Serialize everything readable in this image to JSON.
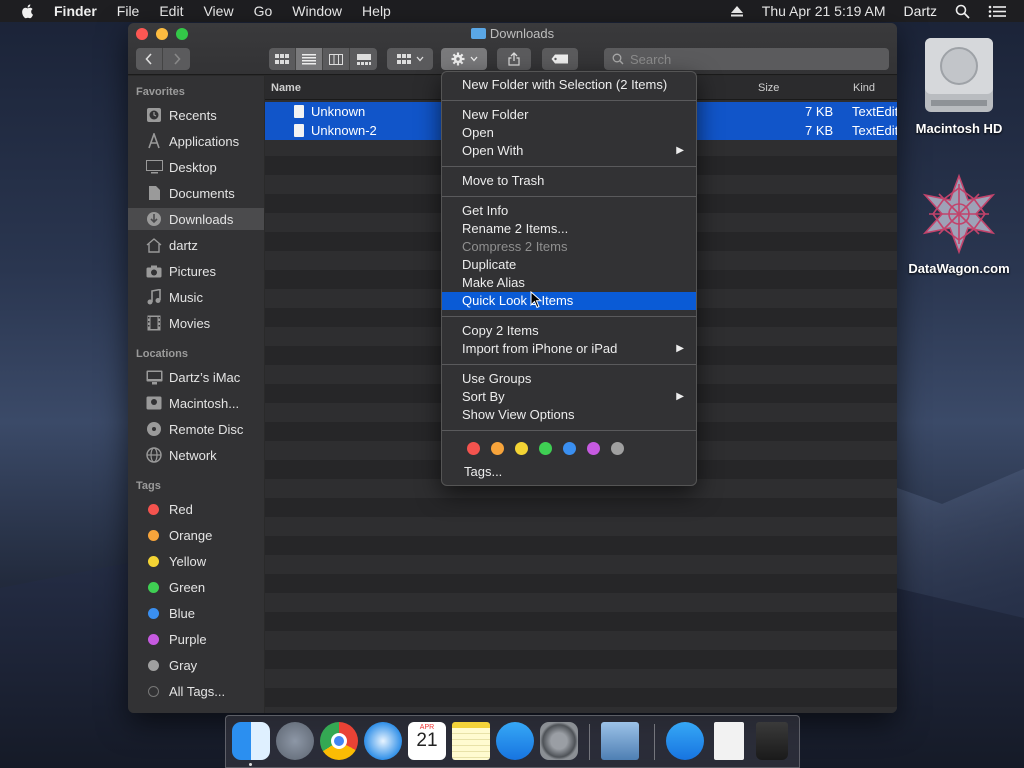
{
  "menubar": {
    "app": "Finder",
    "items": [
      "File",
      "Edit",
      "View",
      "Go",
      "Window",
      "Help"
    ],
    "datetime": "Thu Apr 21  5:19 AM",
    "user": "Dartz"
  },
  "window": {
    "title": "Downloads",
    "search_placeholder": "Search"
  },
  "sidebar": {
    "favorites_header": "Favorites",
    "favorites": [
      "Recents",
      "Applications",
      "Desktop",
      "Documents",
      "Downloads",
      "dartz",
      "Pictures",
      "Music",
      "Movies"
    ],
    "locations_header": "Locations",
    "locations": [
      "Dartz’s iMac",
      "Macintosh...",
      "Remote Disc",
      "Network"
    ],
    "tags_header": "Tags",
    "tags": [
      "Red",
      "Orange",
      "Yellow",
      "Green",
      "Blue",
      "Purple",
      "Gray",
      "All Tags..."
    ],
    "tag_colors": [
      "#f4534e",
      "#f7a43b",
      "#f4d434",
      "#3fcf53",
      "#3a8ff0",
      "#c65ae0",
      "#a0a0a0"
    ]
  },
  "columns": {
    "name": "Name",
    "size": "Size",
    "kind": "Kind"
  },
  "files": [
    {
      "name": "Unknown",
      "size": "7 KB",
      "kind": "TextEdit"
    },
    {
      "name": "Unknown-2",
      "size": "7 KB",
      "kind": "TextEdit"
    }
  ],
  "context_menu": {
    "new_folder_selection": "New Folder with Selection (2 Items)",
    "new_folder": "New Folder",
    "open": "Open",
    "open_with": "Open With",
    "move_to_trash": "Move to Trash",
    "get_info": "Get Info",
    "rename": "Rename 2 Items...",
    "compress": "Compress 2 Items",
    "duplicate": "Duplicate",
    "make_alias": "Make Alias",
    "quick_look": "Quick Look 2 Items",
    "copy": "Copy 2 Items",
    "import": "Import from iPhone or iPad",
    "use_groups": "Use Groups",
    "sort_by": "Sort By",
    "show_view_options": "Show View Options",
    "tags": "Tags...",
    "tag_colors": [
      "#f4534e",
      "#f7a43b",
      "#f4d434",
      "#3fcf53",
      "#3a8ff0",
      "#c65ae0",
      "#a0a0a0"
    ]
  },
  "desktop": {
    "icons": [
      "Macintosh HD",
      "DataWagon.com"
    ]
  },
  "dock": {
    "calendar_month": "APR",
    "calendar_day": "21",
    "apps": [
      "finder-icon",
      "launchpad-icon",
      "chrome-icon",
      "safari-icon",
      "calendar-icon",
      "notes-icon",
      "app-store-icon",
      "system-preferences-icon",
      "preview-icon",
      "app-store-icon",
      "document-icon",
      "trash-icon"
    ]
  }
}
